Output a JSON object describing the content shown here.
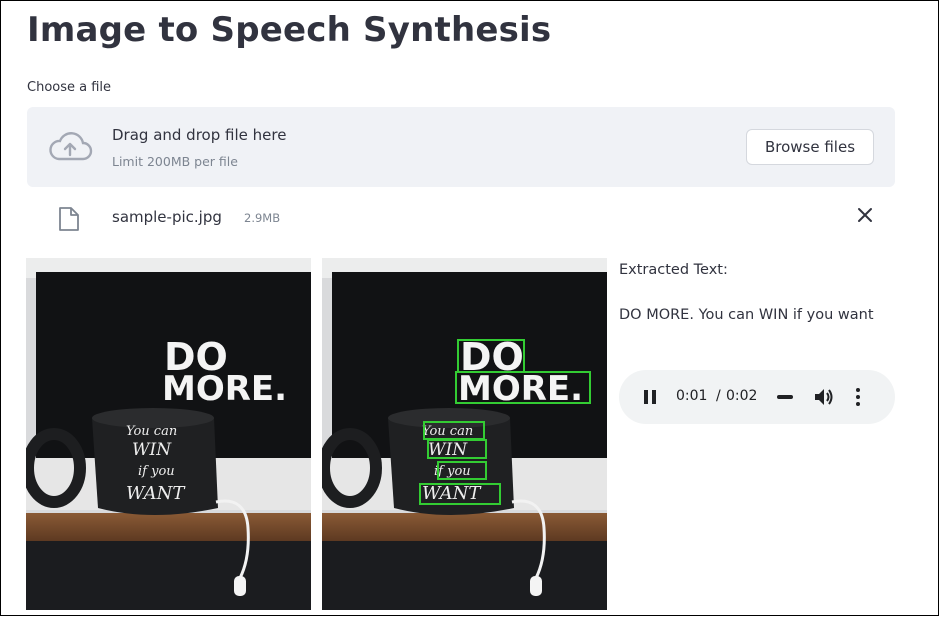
{
  "header": {
    "title": "Image to Speech Synthesis"
  },
  "uploader": {
    "label": "Choose a file",
    "drop_text": "Drag and drop file here",
    "limit_text": "Limit 200MB per file",
    "browse_label": "Browse files"
  },
  "uploaded_file": {
    "name": "sample-pic.jpg",
    "size": "2.9MB"
  },
  "photo": {
    "line1": "DO",
    "line2": "MORE.",
    "mug_line1": "You can",
    "mug_line2": "WIN",
    "mug_line3": "if you",
    "mug_line4": "WANT"
  },
  "result": {
    "label": "Extracted Text:",
    "text": "DO MORE. You can WIN if you want"
  },
  "audio": {
    "current": "0:01",
    "separator": "/",
    "total": "0:02",
    "icons": [
      "pause-icon",
      "progress-icon",
      "volume-icon",
      "more-icon"
    ]
  },
  "colors": {
    "detection_box": "#33cc33",
    "dropzone_bg": "#f0f2f6",
    "text": "#31333f"
  }
}
